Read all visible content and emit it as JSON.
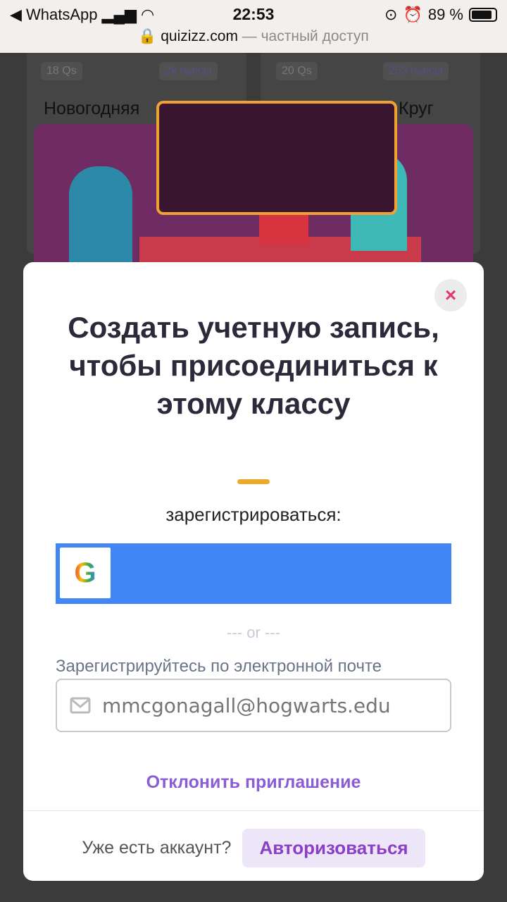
{
  "status_bar": {
    "back_app": "◀ WhatsApp",
    "time": "22:53",
    "battery": "89 %",
    "battery_level": 0.89
  },
  "browser": {
    "domain": "quizizz.com",
    "suffix": " — частный доступ"
  },
  "background": {
    "cards": [
      {
        "questions": "18 Qs",
        "plays": "2k пьесы",
        "title": "Новогодняя"
      },
      {
        "questions": "20 Qs",
        "plays": "253 пьесы",
        "title": "Круг"
      }
    ]
  },
  "modal": {
    "title": "Создать учетную запись, чтобы присоединиться к этому классу",
    "signup_label": "зарегистрироваться:",
    "or": "--- or ---",
    "email_label": "Зарегистрируйтесь по электронной почте",
    "email_placeholder": "mmcgonagall@hogwarts.edu",
    "decline": "Отклонить приглашение",
    "have_account": "Уже есть аккаунт?",
    "login": "Авторизоваться"
  },
  "colors": {
    "google_blue": "#4285f4",
    "accent_purple": "#8a5cd6",
    "close_red": "#e23c6a"
  }
}
